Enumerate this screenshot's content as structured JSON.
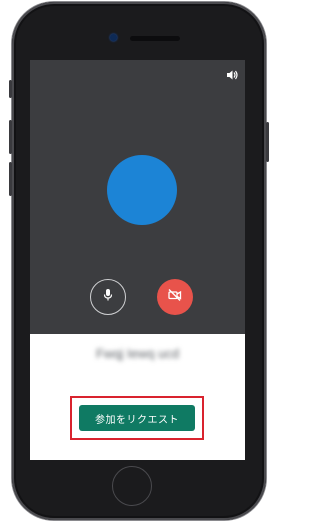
{
  "meeting": {
    "participant_name": "Fwqj Iewq ucd",
    "join_button_label": "参加をリクエスト"
  },
  "controls": {
    "mic": {
      "icon": "microphone-icon",
      "state": "on"
    },
    "camera": {
      "icon": "camera-off-icon",
      "state": "off"
    },
    "volume_icon": "speaker-icon"
  },
  "colors": {
    "avatar": "#1c84d6",
    "join_button": "#0f7a63",
    "camera_off_button": "#e8534b",
    "video_background": "#3c3d40",
    "highlight_box": "#d9232e"
  }
}
